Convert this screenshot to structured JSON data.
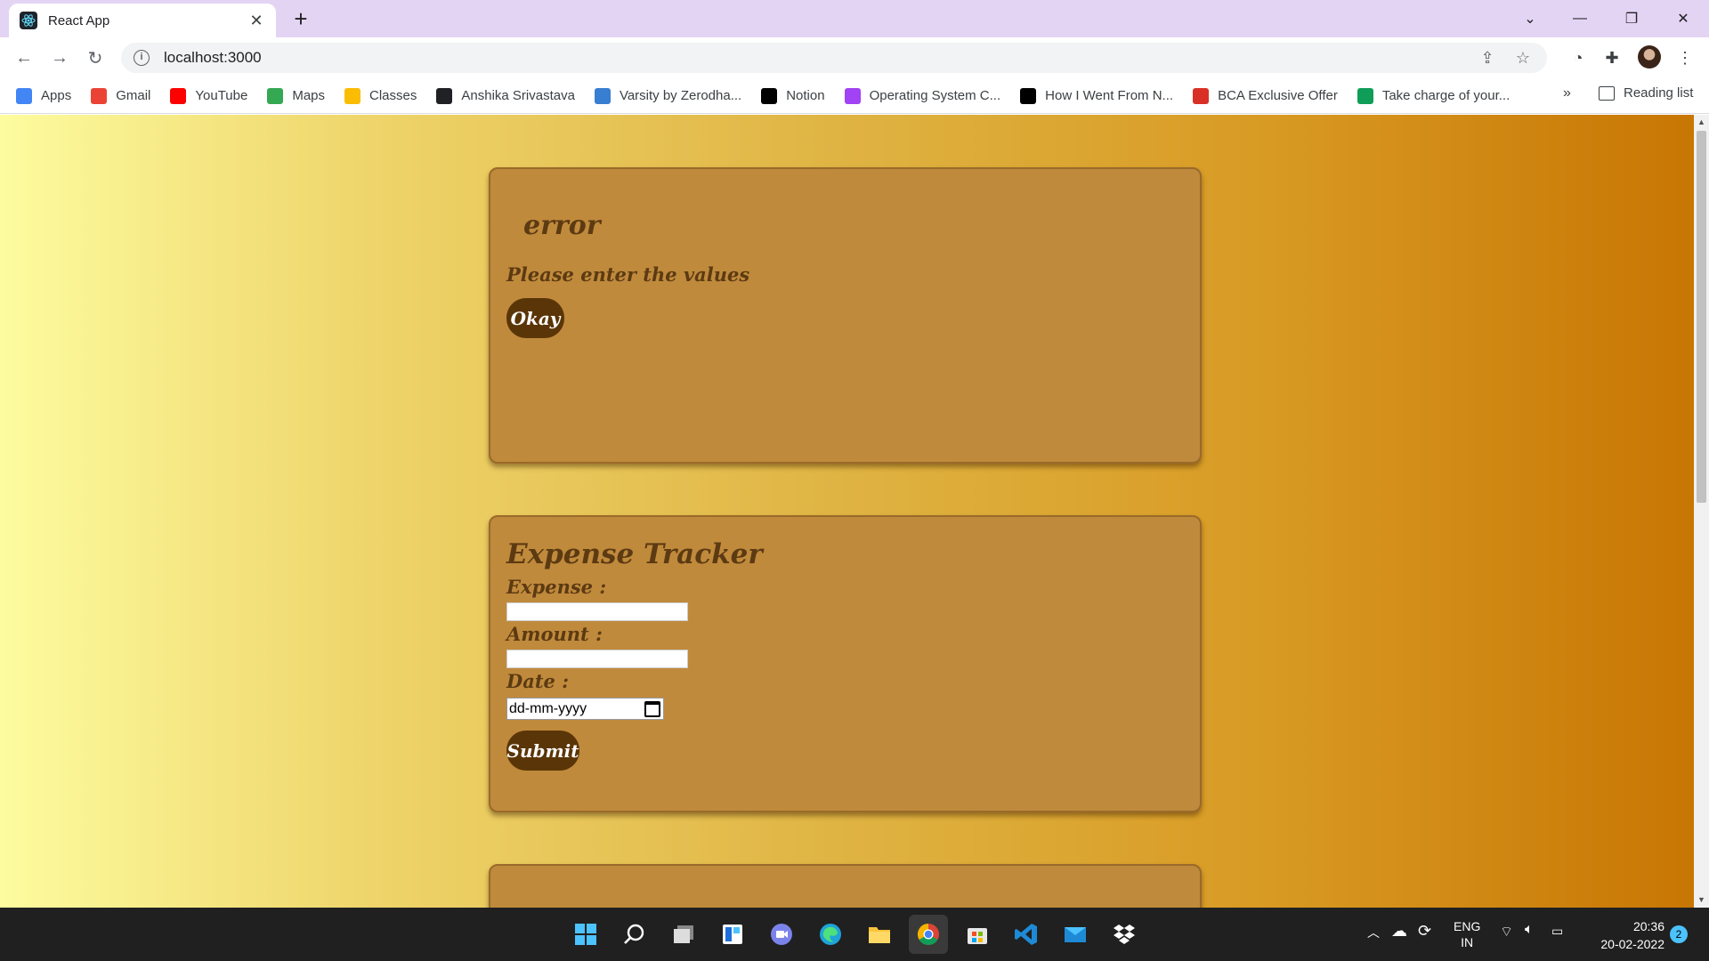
{
  "browser": {
    "tab_title": "React App",
    "url": "localhost:3000",
    "bookmarks": [
      {
        "label": "Apps",
        "icon": "apps-grid-icon",
        "color": "#4285f4"
      },
      {
        "label": "Gmail",
        "icon": "gmail-icon",
        "color": "#ea4335"
      },
      {
        "label": "YouTube",
        "icon": "youtube-icon",
        "color": "#ff0000"
      },
      {
        "label": "Maps",
        "icon": "maps-icon",
        "color": "#34a853"
      },
      {
        "label": "Classes",
        "icon": "classes-icon",
        "color": "#fbbc04"
      },
      {
        "label": "Anshika Srivastava",
        "icon": "globe-icon",
        "color": "#202124"
      },
      {
        "label": "Varsity by Zerodha...",
        "icon": "varsity-icon",
        "color": "#387ed1"
      },
      {
        "label": "Notion",
        "icon": "notion-icon",
        "color": "#000000"
      },
      {
        "label": "Operating System C...",
        "icon": "m-icon",
        "color": "#a142f4"
      },
      {
        "label": "How I Went From N...",
        "icon": "medium-icon",
        "color": "#000000"
      },
      {
        "label": "BCA Exclusive Offer",
        "icon": "offer-icon",
        "color": "#d93025"
      },
      {
        "label": "Take charge of your...",
        "icon": "drive-icon",
        "color": "#0f9d58"
      }
    ],
    "reading_list": "Reading list"
  },
  "error_modal": {
    "title": "error",
    "message": "Please enter the values",
    "button": "Okay"
  },
  "expense_form": {
    "title": "Expense Tracker",
    "expense_label": "Expense :",
    "amount_label": "Amount :",
    "date_label": "Date :",
    "date_placeholder": "dd-mm-yyyy",
    "submit": "Submit"
  },
  "colors": {
    "card": "#c08a3c",
    "button": "#5a3507",
    "text": "#5c3a12"
  },
  "taskbar": {
    "lang": "ENG",
    "region": "IN",
    "time": "20:36",
    "date": "20-02-2022",
    "notifications": "2"
  }
}
